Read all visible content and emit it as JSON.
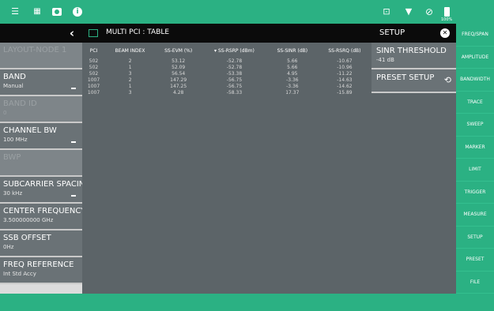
{
  "topbar": {
    "icons": [
      "menu-icon",
      "grid-icon",
      "camera-icon",
      "info-icon",
      "screen-icon",
      "wifi-icon",
      "no-signal-icon",
      "battery-icon"
    ],
    "battery_label": "100%",
    "accent_color": "#2bb183"
  },
  "left_panel": {
    "items": [
      {
        "title": "LAYOUT-NODE 1",
        "sub": "",
        "disabled": true
      },
      {
        "title": "BAND",
        "sub": "Manual",
        "disabled": false,
        "dropdown": true
      },
      {
        "title": "BAND ID",
        "sub": "0",
        "disabled": true
      },
      {
        "title": "CHANNEL BW",
        "sub": "100 MHz",
        "disabled": false,
        "dropdown": true
      },
      {
        "title": "BWP",
        "sub": "",
        "disabled": true
      },
      {
        "title": "SUBCARRIER SPACING",
        "sub": "30 kHz",
        "disabled": false,
        "dropdown": true
      },
      {
        "title": "CENTER FREQUENCY",
        "sub": "3.500000000 GHz",
        "disabled": false
      },
      {
        "title": "SSB OFFSET",
        "sub": "0Hz",
        "disabled": false
      },
      {
        "title": "FREQ REFERENCE",
        "sub": "Int Std Accy",
        "disabled": false
      }
    ]
  },
  "table": {
    "title": "MULTI PCI : TABLE",
    "columns": [
      "PCI",
      "BEAM INDEX",
      "SS-EVM (%)",
      "▾ SS-RSRP (dBm)",
      "SS-SINR (dB)",
      "SS-RSRQ (dB)"
    ],
    "rows": [
      [
        "502",
        "2",
        "53.12",
        "-52.78",
        "5.66",
        "-10.67"
      ],
      [
        "502",
        "1",
        "52.09",
        "-52.78",
        "5.66",
        "-10.96"
      ],
      [
        "502",
        "3",
        "56.54",
        "-53.38",
        "4.95",
        "-11.22"
      ],
      [
        "1007",
        "2",
        "147.29",
        "-56.75",
        "-3.36",
        "-14.63"
      ],
      [
        "1007",
        "1",
        "147.25",
        "-56.75",
        "-3.36",
        "-14.62"
      ],
      [
        "1007",
        "3",
        "4.28",
        "-58.33",
        "17.37",
        "-15.89"
      ]
    ]
  },
  "setup_panel": {
    "title": "SETUP",
    "items": [
      {
        "title": "SINR THRESHOLD",
        "sub": "-41 dB"
      },
      {
        "title": "PRESET SETUP",
        "sub": ""
      }
    ]
  },
  "right_nav": {
    "items": [
      "FREQ/SPAN",
      "AMPLITUDE",
      "BANDWIDTH",
      "TRACE",
      "SWEEP",
      "MARKER",
      "LIMIT",
      "TRIGGER",
      "MEASURE",
      "SETUP",
      "PRESET",
      "FILE"
    ]
  }
}
